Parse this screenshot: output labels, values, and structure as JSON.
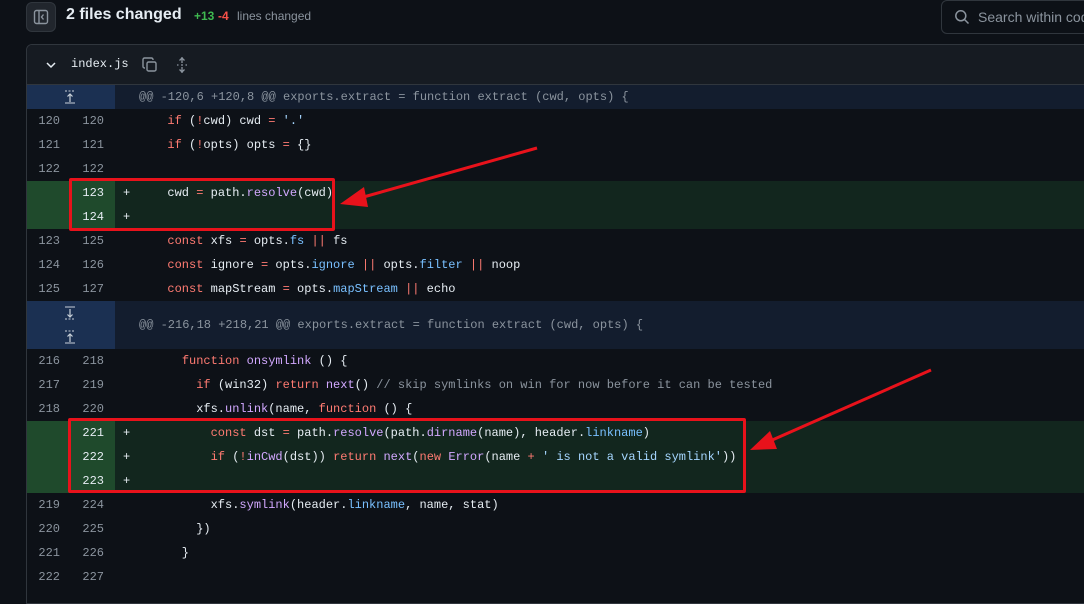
{
  "header": {
    "files_changed": "2 files changed",
    "additions": "+13",
    "deletions": "-4",
    "lines_changed": "lines changed",
    "search_placeholder": "Search within code"
  },
  "file": {
    "name": "index.js"
  },
  "hunks": [
    {
      "header": "@@ -120,6 +120,8 @@ exports.extract = function extract (cwd, opts) {"
    },
    {
      "header": "@@ -216,18 +218,21 @@ exports.extract = function extract (cwd, opts) {"
    }
  ],
  "lines": [
    {
      "old": "120",
      "new": "120",
      "sign": "",
      "code": "  if (!cwd) cwd = '.'"
    },
    {
      "old": "121",
      "new": "121",
      "sign": "",
      "code": "  if (!opts) opts = {}"
    },
    {
      "old": "122",
      "new": "122",
      "sign": "",
      "code": ""
    },
    {
      "old": "",
      "new": "123",
      "sign": "+",
      "code": "  cwd = path.resolve(cwd)"
    },
    {
      "old": "",
      "new": "124",
      "sign": "+",
      "code": ""
    },
    {
      "old": "123",
      "new": "125",
      "sign": "",
      "code": "  const xfs = opts.fs || fs"
    },
    {
      "old": "124",
      "new": "126",
      "sign": "",
      "code": "  const ignore = opts.ignore || opts.filter || noop"
    },
    {
      "old": "125",
      "new": "127",
      "sign": "",
      "code": "  const mapStream = opts.mapStream || echo"
    },
    {
      "old": "216",
      "new": "218",
      "sign": "",
      "code": "    function onsymlink () {"
    },
    {
      "old": "217",
      "new": "219",
      "sign": "",
      "code": "      if (win32) return next() // skip symlinks on win for now before it can be tested"
    },
    {
      "old": "218",
      "new": "220",
      "sign": "",
      "code": "      xfs.unlink(name, function () {"
    },
    {
      "old": "",
      "new": "221",
      "sign": "+",
      "code": "        const dst = path.resolve(path.dirname(name), header.linkname)"
    },
    {
      "old": "",
      "new": "222",
      "sign": "+",
      "code": "        if (!inCwd(dst)) return next(new Error(name + ' is not a valid symlink'))"
    },
    {
      "old": "",
      "new": "223",
      "sign": "+",
      "code": ""
    },
    {
      "old": "219",
      "new": "224",
      "sign": "",
      "code": "        xfs.symlink(header.linkname, name, stat)"
    },
    {
      "old": "220",
      "new": "225",
      "sign": "",
      "code": "      })"
    },
    {
      "old": "221",
      "new": "226",
      "sign": "",
      "code": "    }"
    },
    {
      "old": "222",
      "new": "227",
      "sign": "",
      "code": ""
    }
  ],
  "colors": {
    "addition_bg": "#12261e",
    "addition_gutter": "#1f4a2c",
    "hunk_bg": "#131d2e",
    "annotation_red": "#e8121b"
  }
}
